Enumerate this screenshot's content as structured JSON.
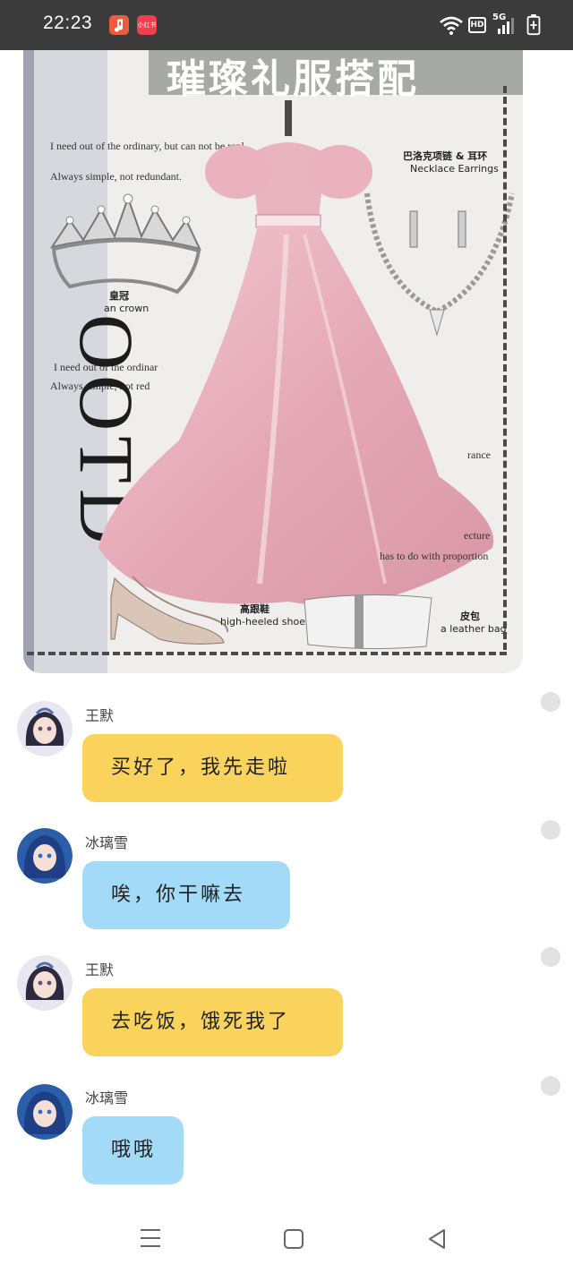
{
  "status_bar": {
    "time": "22:23",
    "app2_label": "小红书",
    "hd_label": "HD",
    "network_label": "5G"
  },
  "post_image": {
    "title": "璀璨礼服搭配",
    "left_text_1": "I need out of the ordinary, but can not be repl",
    "left_text_2": "Always simple, not redundant.",
    "left_text_3": "I need out of the ordinar",
    "left_text_4": "Always simple, not red",
    "ootd": "OOTD",
    "crown_cn": "皇冠",
    "crown_en": "an crown",
    "necklace_cn": "巴洛克项链 & 耳环",
    "necklace_en": "Necklace Earrings",
    "heels_cn": "高跟鞋",
    "heels_en": "high-heeled shoes",
    "bag_cn": "皮包",
    "bag_en": "a leather bag",
    "right_text_1": "rance",
    "right_text_2": "ecture",
    "right_text_3": "has to do with proportion"
  },
  "messages": [
    {
      "sender": "王默",
      "text": "买好了，我先走啦",
      "color": "#fad35c",
      "avatar": "wangmo-avatar"
    },
    {
      "sender": "冰璃雪",
      "text": "唉，你干嘛去",
      "color": "#a3daf8",
      "avatar": "binglixue-avatar"
    },
    {
      "sender": "王默",
      "text": "去吃饭，饿死我了",
      "color": "#fad35c",
      "avatar": "wangmo-avatar"
    },
    {
      "sender": "冰璃雪",
      "text": "哦哦",
      "color": "#a3daf8",
      "avatar": "binglixue-avatar"
    }
  ],
  "icons": {
    "nav_menu": "menu-icon",
    "nav_home": "home-icon",
    "nav_back": "back-icon"
  }
}
